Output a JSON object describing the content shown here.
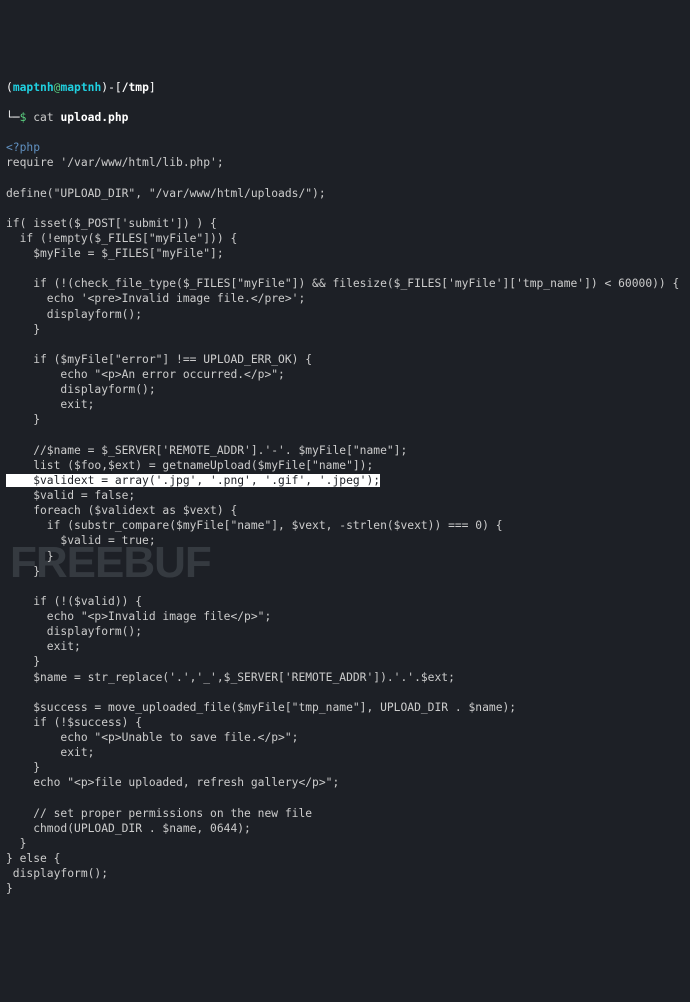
{
  "prompt": {
    "open_paren": "(",
    "user": "maptnh",
    "at": "@",
    "host": "maptnh",
    "close_paren": ")",
    "dash": "-",
    "open_bracket": "[",
    "path": "/tmp",
    "close_bracket": "]",
    "symbol": "$",
    "cmd": "cat ",
    "filename": "upload.php"
  },
  "php_open": "<?php",
  "code_lines": {
    "l1": "require '/var/www/html/lib.php';",
    "l2": "",
    "l3": "define(\"UPLOAD_DIR\", \"/var/www/html/uploads/\");",
    "l4": "",
    "l5": "if( isset($_POST['submit']) ) {",
    "l6": "  if (!empty($_FILES[\"myFile\"])) {",
    "l7": "    $myFile = $_FILES[\"myFile\"];",
    "l8": "",
    "l9": "    if (!(check_file_type($_FILES[\"myFile\"]) && filesize($_FILES['myFile']['tmp_name']) < 60000)) {",
    "l10": "      echo '<pre>Invalid image file.</pre>';",
    "l11": "      displayform();",
    "l12": "    }",
    "l13": "",
    "l14": "    if ($myFile[\"error\"] !== UPLOAD_ERR_OK) {",
    "l15": "        echo \"<p>An error occurred.</p>\";",
    "l16": "        displayform();",
    "l17": "        exit;",
    "l18": "    }",
    "l19": "",
    "l20": "    //$name = $_SERVER['REMOTE_ADDR'].'-'. $myFile[\"name\"];",
    "l21": "    list ($foo,$ext) = getnameUpload($myFile[\"name\"]);",
    "highlighted": "    $validext = array('.jpg', '.png', '.gif', '.jpeg');",
    "l22": "    $valid = false;",
    "l23": "    foreach ($validext as $vext) {",
    "l24": "      if (substr_compare($myFile[\"name\"], $vext, -strlen($vext)) === 0) {",
    "l25": "        $valid = true;",
    "l26": "      }",
    "l27": "    }",
    "l28": "",
    "l29": "    if (!($valid)) {",
    "l30": "      echo \"<p>Invalid image file</p>\";",
    "l31": "      displayform();",
    "l32": "      exit;",
    "l33": "    }",
    "l34": "    $name = str_replace('.','_',$_SERVER['REMOTE_ADDR']).'.'.$ext;",
    "l35": "",
    "l36": "    $success = move_uploaded_file($myFile[\"tmp_name\"], UPLOAD_DIR . $name);",
    "l37": "    if (!$success) {",
    "l38": "        echo \"<p>Unable to save file.</p>\";",
    "l39": "        exit;",
    "l40": "    }",
    "l41": "    echo \"<p>file uploaded, refresh gallery</p>\";",
    "l42": "",
    "l43": "    // set proper permissions on the new file",
    "l44": "    chmod(UPLOAD_DIR . $name, 0644);",
    "l45": "  }",
    "l46": "} else {",
    "l47": " displayform();",
    "l48": "}"
  },
  "watermark": "FREEBUF"
}
